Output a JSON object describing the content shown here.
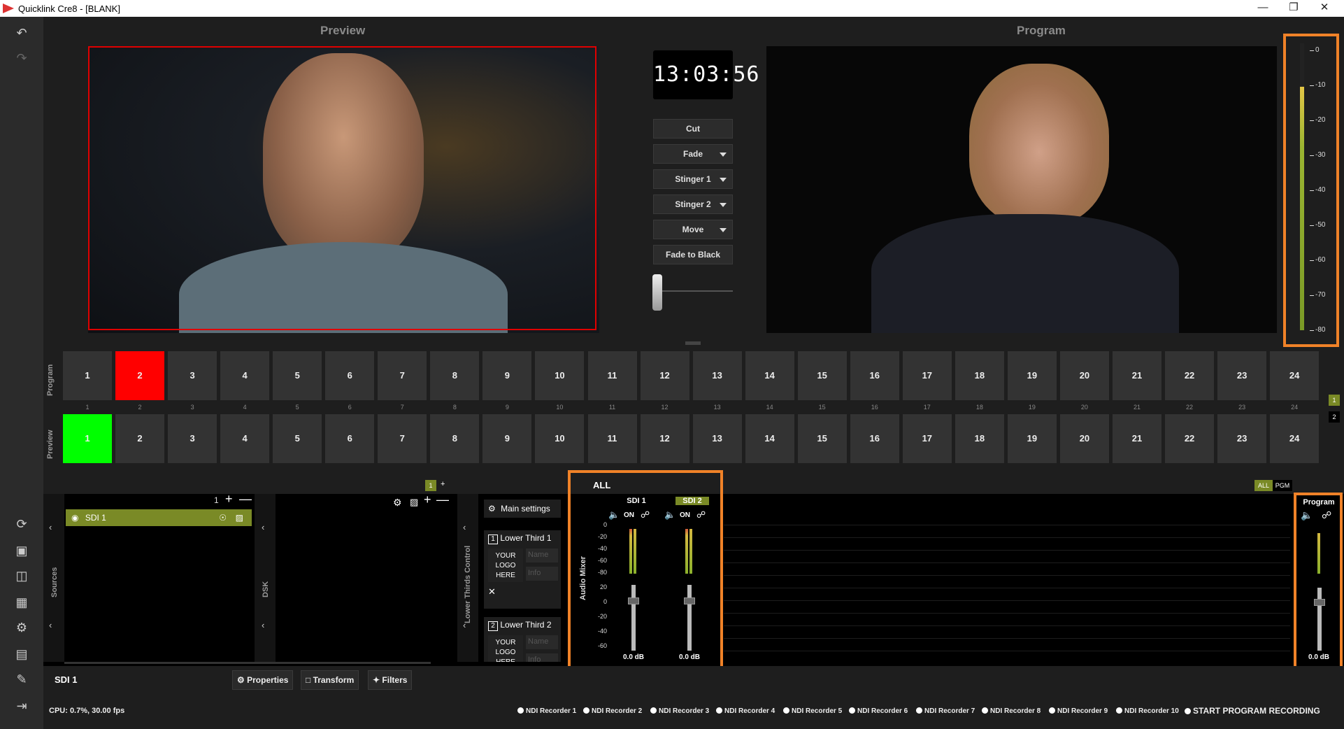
{
  "window": {
    "title": "Quicklink Cre8  - [BLANK]"
  },
  "panels": {
    "preview_title": "Preview",
    "program_title": "Program"
  },
  "clock": "13:03:56",
  "transitions": [
    {
      "label": "Cut",
      "dropdown": false
    },
    {
      "label": "Fade",
      "dropdown": true
    },
    {
      "label": "Stinger 1",
      "dropdown": true
    },
    {
      "label": "Stinger 2",
      "dropdown": true
    },
    {
      "label": "Move",
      "dropdown": true
    },
    {
      "label": "Fade to Black",
      "dropdown": false
    }
  ],
  "meter": {
    "ticks": [
      "0",
      "-10",
      "-20",
      "-30",
      "-40",
      "-50",
      "-60",
      "-70",
      "-80"
    ],
    "level_fraction": 0.85
  },
  "bus": {
    "program_label": "Program",
    "preview_label": "Preview",
    "buttons": [
      "1",
      "2",
      "3",
      "4",
      "5",
      "6",
      "7",
      "8",
      "9",
      "10",
      "11",
      "12",
      "13",
      "14",
      "15",
      "16",
      "17",
      "18",
      "19",
      "20",
      "21",
      "22",
      "23",
      "24"
    ],
    "program_active": "2",
    "preview_active": "1",
    "page_indicators": [
      "1",
      "2"
    ]
  },
  "sources": {
    "label": "Sources",
    "count": "1",
    "items": [
      {
        "name": "SDI 1"
      }
    ]
  },
  "dsk": {
    "label": "DSK",
    "count": "1"
  },
  "lower_thirds": {
    "label": "Lower Thirds Control",
    "main_settings": "Main settings",
    "items": [
      {
        "num": "1",
        "title": "Lower Third 1",
        "logo": "YOUR LOGO HERE",
        "name_ph": "Name",
        "info_ph": "Info"
      },
      {
        "num": "2",
        "title": "Lower Third 2",
        "logo": "YOUR LOGO HERE",
        "name_ph": "Name",
        "info_ph": "Info"
      }
    ]
  },
  "audio": {
    "label": "Audio Mixer",
    "all": "ALL",
    "tab_all": "ALL",
    "tab_pgm": "PGM",
    "scale": [
      "0",
      "-20",
      "-40",
      "-60",
      "-80",
      "20",
      "0",
      "-20",
      "-40",
      "-60"
    ],
    "channels": [
      {
        "name": "SDI 1",
        "on": "ON",
        "db": "0.0 dB"
      },
      {
        "name": "SDI 2",
        "on": "ON",
        "db": "0.0 dB"
      }
    ],
    "program": {
      "name": "Program",
      "db": "0.0 dB"
    }
  },
  "selection": {
    "name": "SDI 1"
  },
  "toolbar": {
    "properties": "Properties",
    "transform": "Transform",
    "filters": "Filters"
  },
  "status": {
    "cpu": "CPU: 0.7%, 30.00 fps",
    "recorders": [
      "NDI Recorder 1",
      "NDI Recorder 2",
      "NDI Recorder 3",
      "NDI Recorder 4",
      "NDI Recorder 5",
      "NDI Recorder 6",
      "NDI Recorder 7",
      "NDI Recorder 8",
      "NDI Recorder 9",
      "NDI Recorder 10"
    ],
    "start_recording": "START PROGRAM RECORDING"
  },
  "colors": {
    "accent": "#f08228",
    "program_red": "#ff0000",
    "preview_green": "#00ff00",
    "olive": "#7a8a26"
  }
}
